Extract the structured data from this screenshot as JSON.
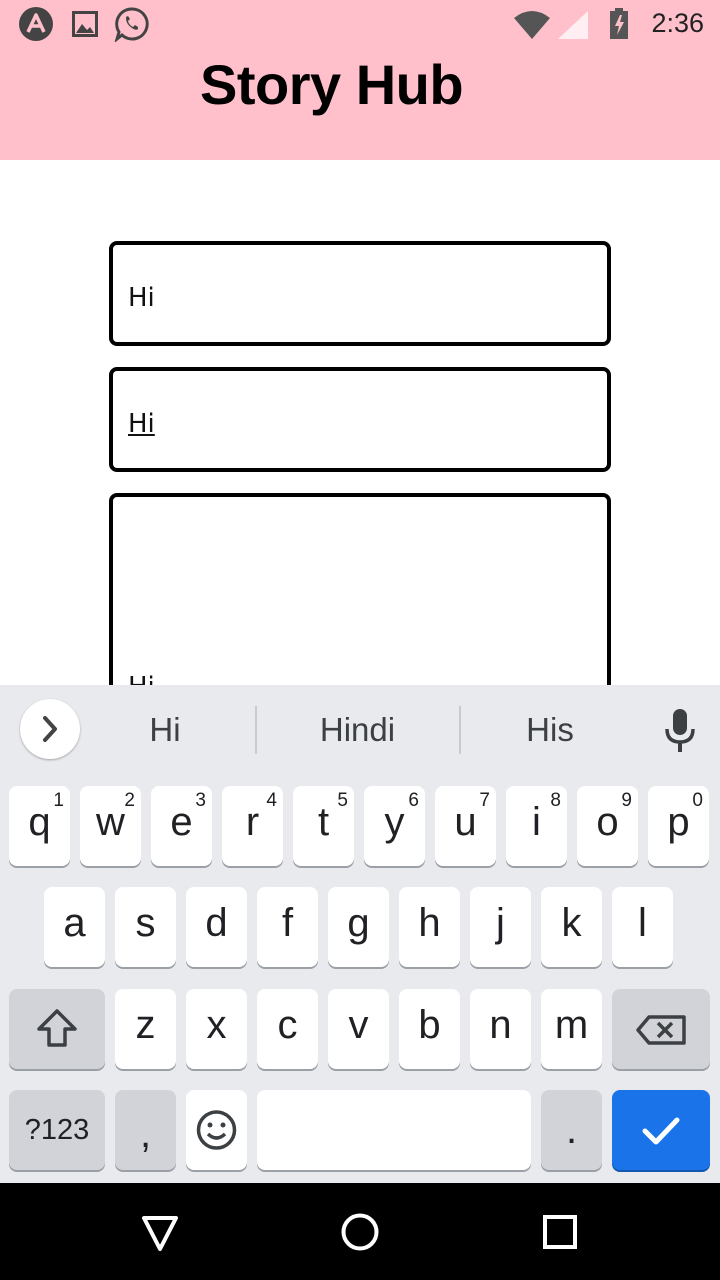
{
  "status_bar": {
    "time": "2:36",
    "icons": [
      "app-launcher-icon",
      "image-icon",
      "whatsapp-icon",
      "wifi-icon",
      "signal-icon",
      "battery-icon"
    ]
  },
  "header": {
    "title": "Story Hub",
    "background": "#ffc0cb"
  },
  "form": {
    "title_value": "Hi",
    "author_value": "Hi",
    "story_value": "Hi"
  },
  "keyboard": {
    "suggestions": [
      "Hi",
      "Hindi",
      "His"
    ],
    "row1": [
      {
        "key": "q",
        "hint": "1"
      },
      {
        "key": "w",
        "hint": "2"
      },
      {
        "key": "e",
        "hint": "3"
      },
      {
        "key": "r",
        "hint": "4"
      },
      {
        "key": "t",
        "hint": "5"
      },
      {
        "key": "y",
        "hint": "6"
      },
      {
        "key": "u",
        "hint": "7"
      },
      {
        "key": "i",
        "hint": "8"
      },
      {
        "key": "o",
        "hint": "9"
      },
      {
        "key": "p",
        "hint": "0"
      }
    ],
    "row2": [
      "a",
      "s",
      "d",
      "f",
      "g",
      "h",
      "j",
      "k",
      "l"
    ],
    "row3": [
      "z",
      "x",
      "c",
      "v",
      "b",
      "n",
      "m"
    ],
    "symbols_label": "?123",
    "comma": ",",
    "period": ".",
    "accent": "#1a73e8"
  },
  "nav": {
    "icons": [
      "back-icon",
      "home-icon",
      "recents-icon"
    ]
  }
}
